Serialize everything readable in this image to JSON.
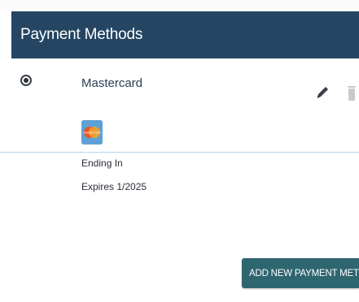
{
  "header": {
    "title": "Payment Methods"
  },
  "payment_method": {
    "selected": true,
    "card_name": "Mastercard",
    "card_logo_icon": "mastercard-logo-icon",
    "card_logo_text": "MasterCard",
    "ending_label": "Ending In",
    "expires_label": "Expires 1/2025",
    "edit_icon": "pencil-icon",
    "delete_icon": "trash-icon"
  },
  "actions": {
    "add_new_label": "ADD NEW PAYMENT METHOD"
  },
  "colors": {
    "header_bg": "#254563",
    "button_bg": "#2e6670",
    "divider": "#b9d3e3",
    "card_logo_bg": "#5ea0d6"
  }
}
